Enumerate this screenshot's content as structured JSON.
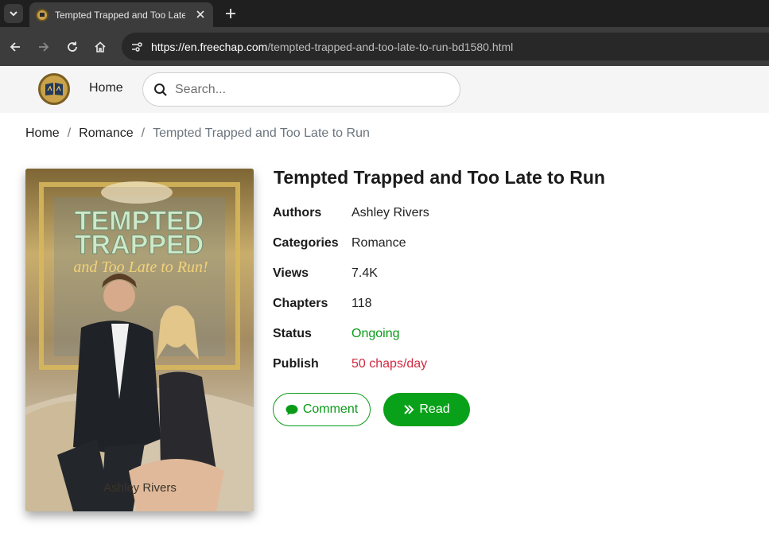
{
  "browser": {
    "tab_title": "Tempted Trapped and Too Late to Run",
    "url_host": "https://en.freechap.com",
    "url_path": "/tempted-trapped-and-too-late-to-run-bd1580.html"
  },
  "header": {
    "home_label": "Home",
    "search_placeholder": "Search..."
  },
  "breadcrumb": {
    "home": "Home",
    "category": "Romance",
    "current": "Tempted Trapped and Too Late to Run"
  },
  "cover": {
    "title_line1": "TEMPTED",
    "title_line2": "TRAPPED",
    "subtitle": "and Too Late to Run!",
    "author": "Ashley Rivers"
  },
  "book": {
    "title": "Tempted Trapped and Too Late to Run",
    "fields": [
      {
        "label": "Authors",
        "value": "Ashley Rivers"
      },
      {
        "label": "Categories",
        "value": "Romance"
      },
      {
        "label": "Views",
        "value": "7.4K"
      },
      {
        "label": "Chapters",
        "value": "118"
      },
      {
        "label": "Status",
        "value": "Ongoing"
      },
      {
        "label": "Publish",
        "value": "50 chaps/day"
      }
    ]
  },
  "actions": {
    "comment_label": "Comment",
    "read_label": "Read"
  },
  "colors": {
    "accent_green": "#0aa11a",
    "status_green": "#0a9a18",
    "publish_red": "#d02a40"
  },
  "icons": [
    "tab-list-icon",
    "favicon-icon",
    "close-icon",
    "plus-icon",
    "back-icon",
    "forward-icon",
    "reload-icon",
    "home-icon",
    "site-info-icon",
    "logo-icon",
    "search-icon",
    "comment-icon",
    "double-chevron-right-icon"
  ]
}
